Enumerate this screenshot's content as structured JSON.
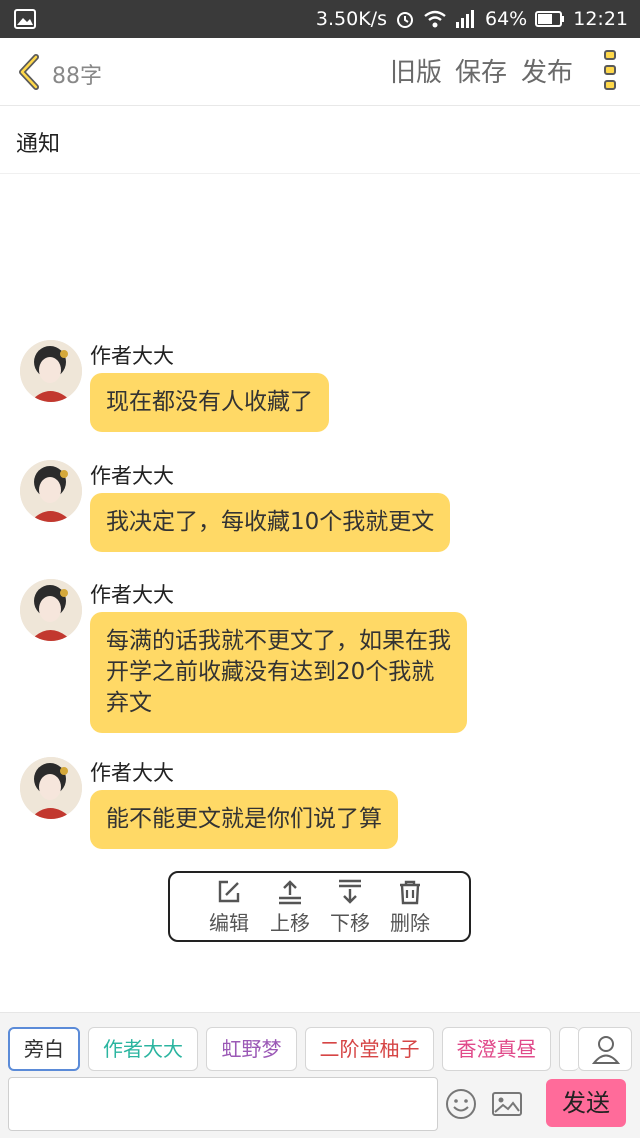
{
  "status_bar": {
    "speed": "3.50K/s",
    "battery": "64%",
    "time": "12:21"
  },
  "header": {
    "word_count": "88字",
    "old_version": "旧版",
    "save": "保存",
    "publish": "发布"
  },
  "title": "通知",
  "messages": [
    {
      "sender": "作者大大",
      "lines": [
        "现在都没有人收藏了"
      ]
    },
    {
      "sender": "作者大大",
      "lines": [
        "我决定了，每收藏10个我就更文"
      ]
    },
    {
      "sender": "作者大大",
      "lines": [
        "每满的话我就不更文了，如果在我",
        "开学之前收藏没有达到20个我就",
        "弃文"
      ]
    },
    {
      "sender": "作者大大",
      "lines": [
        "能不能更文就是你们说了算"
      ]
    }
  ],
  "actions": {
    "edit": "编辑",
    "move_up": "上移",
    "move_down": "下移",
    "delete": "删除"
  },
  "roles": [
    {
      "label": "旁白",
      "color": "#333333"
    },
    {
      "label": "作者大大",
      "color": "#2bb5a0"
    },
    {
      "label": "虹野梦",
      "color": "#9b59b6"
    },
    {
      "label": "二阶堂柚子",
      "color": "#d64545"
    },
    {
      "label": "香澄真昼",
      "color": "#e04a8a"
    }
  ],
  "send": "发送",
  "colors": {
    "bubble": "#ffd966",
    "send_button": "#ff6b9a",
    "status_bar": "#3a3a3a"
  }
}
